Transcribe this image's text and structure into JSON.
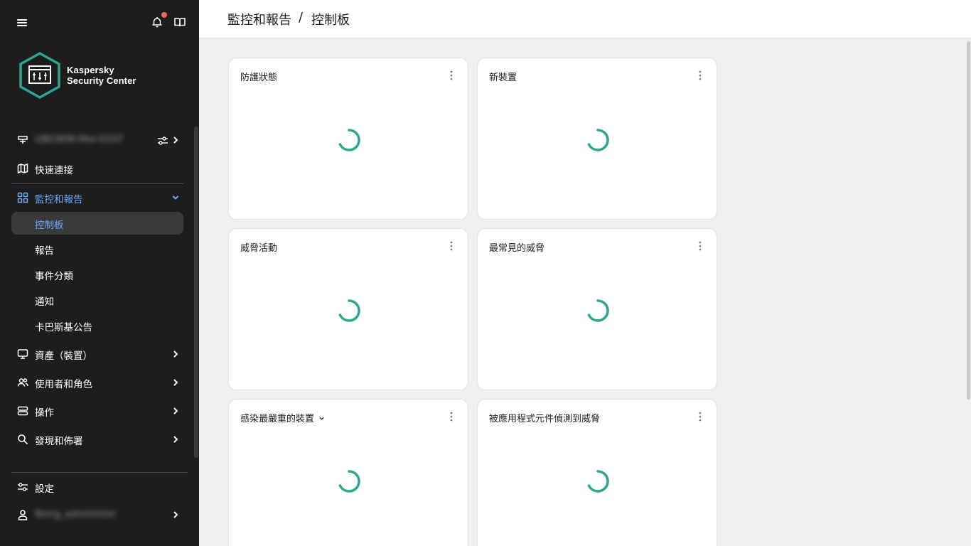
{
  "sidebar": {
    "logo": {
      "line1": "Kaspersky",
      "line2": "Security Center"
    },
    "server_name": "UBGWIN-Mel-0107",
    "items": [
      {
        "label": "快速連接"
      },
      {
        "label": "監控和報告"
      },
      {
        "label": "資產（裝置）"
      },
      {
        "label": "使用者和角色"
      },
      {
        "label": "操作"
      },
      {
        "label": "發現和佈署"
      }
    ],
    "subitems": [
      {
        "label": "控制板"
      },
      {
        "label": "報告"
      },
      {
        "label": "事件分類"
      },
      {
        "label": "通知"
      },
      {
        "label": "卡巴斯基公告"
      }
    ],
    "settings_label": "設定",
    "user_name": "Nong_administer"
  },
  "header": {
    "breadcrumb_parent": "監控和報告",
    "separator": "/",
    "breadcrumb_current": "控制板"
  },
  "widgets": [
    {
      "title": "防護狀態"
    },
    {
      "title": "新裝置"
    },
    {
      "title": "威脅活動"
    },
    {
      "title": "最常見的威脅"
    },
    {
      "title": "感染最嚴重的裝置"
    },
    {
      "title": "被應用程式元件偵測到威脅"
    }
  ],
  "colors": {
    "sidebar_bg": "#1d1d1b",
    "accent_blue": "#6fa8ff",
    "spinner_teal": "#2aa78e",
    "notification_dot": "#f0685c"
  }
}
